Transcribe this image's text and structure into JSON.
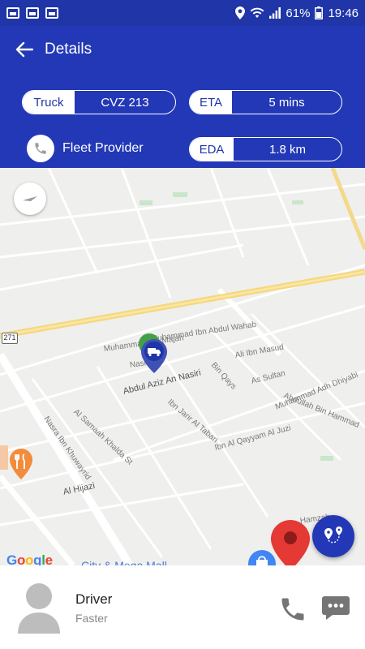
{
  "status_bar": {
    "battery": "61%",
    "time": "19:46"
  },
  "app_bar": {
    "title": "Details"
  },
  "details": {
    "truck": {
      "label": "Truck",
      "value": "CVZ 213"
    },
    "eta": {
      "label": "ETA",
      "value": "5 mins"
    },
    "eda": {
      "label": "EDA",
      "value": "1.8 km"
    },
    "provider": "Fleet Provider"
  },
  "map": {
    "route_badge": "271",
    "streets": {
      "muhammad": "Muhammad Ibn Majah",
      "abdul_wahab": "Muhammad Ibn Abdul Wahab",
      "nasiri_short": "Nasi",
      "abdul_aziz": "Abdul Aziz An Nasiri",
      "ali": "Ali Ibn Masud",
      "bin_qays": "Bin Qays",
      "as_sultan": "As Sultan",
      "al_tabari": "Ibn Jarir Al Tabari",
      "abdullah": "Abdullah Bin Hammad",
      "muhammad_dhiyab": "Muhammad Adh Dhiyabi",
      "al_ghayyam": "Ibn Al Qayyam Al Juzi",
      "samaah": "Al Samaah Khalda St",
      "nasra": "Nasra Ibn Khuwayrid",
      "hijazi": "Al Hijazi",
      "hamzah": "Hamzah",
      "mall": "City & Mega Mall"
    },
    "google_logo": {
      "letters": [
        "G",
        "o",
        "o",
        "g",
        "l",
        "e"
      ],
      "colors": [
        "#4285f4",
        "#ea4335",
        "#fbbc05",
        "#4285f4",
        "#34a853",
        "#ea4335"
      ]
    }
  },
  "driver": {
    "name": "Driver",
    "subtitle": "Faster"
  },
  "colors": {
    "primary": "#2238b6",
    "status_bar": "#1f35a8",
    "marker_red": "#e53935",
    "marker_green": "#43a047"
  }
}
